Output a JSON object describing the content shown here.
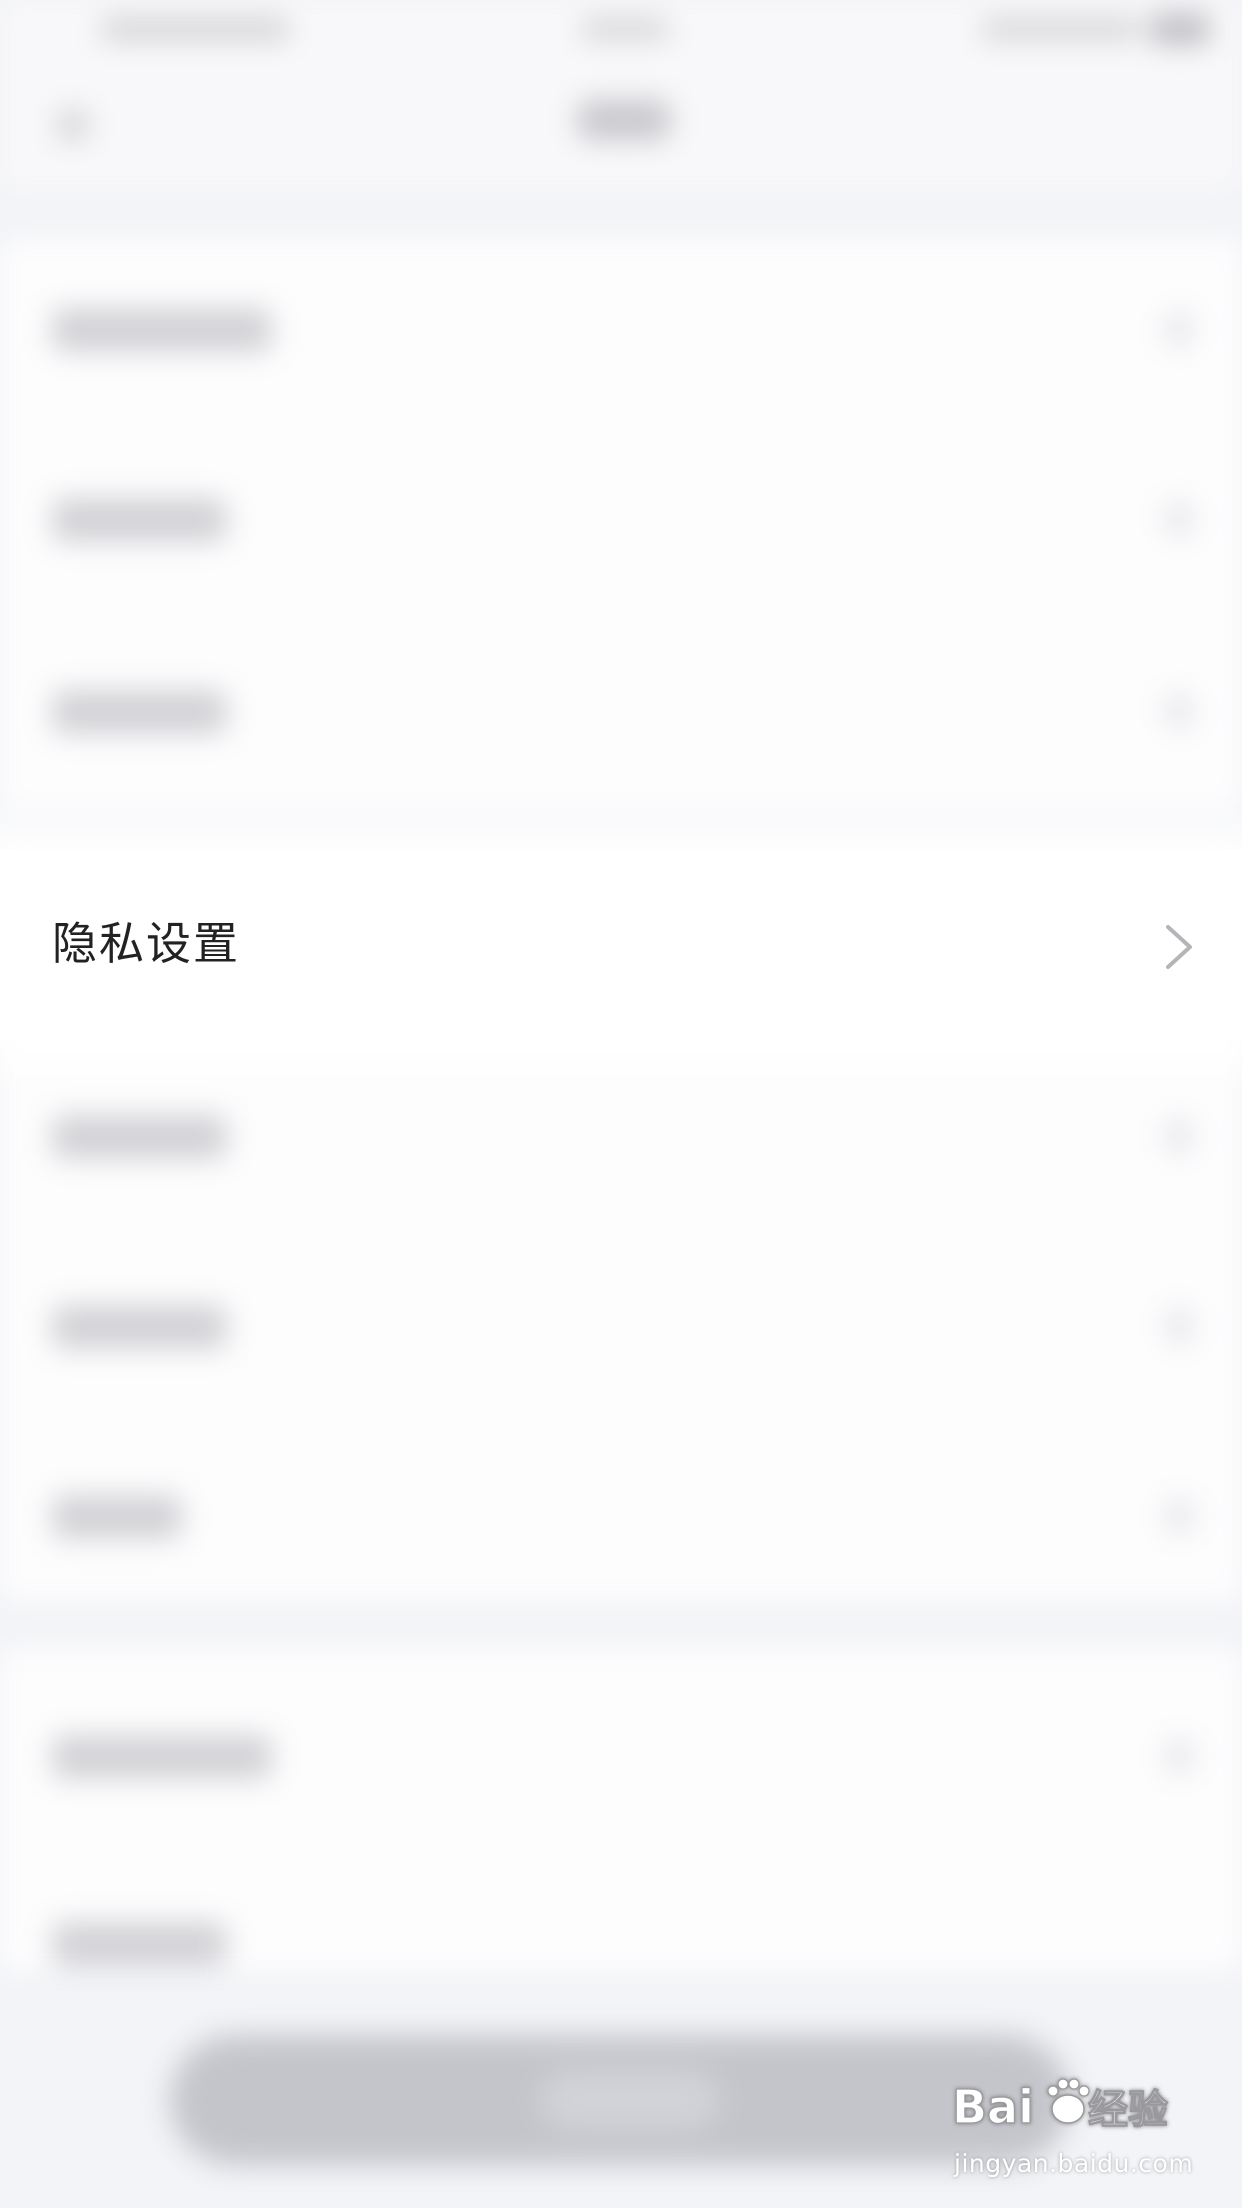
{
  "privacy_row": {
    "label": "隐私设置",
    "chevron_icon": "chevron-right-icon"
  },
  "watermark": {
    "logo_text": "Baidu经验",
    "url": "jingyan.baidu.com"
  },
  "colors": {
    "background": "#f3f4f7",
    "row_background": "#ffffff",
    "label_text": "#222222",
    "chevron": "#b5b5b9"
  }
}
